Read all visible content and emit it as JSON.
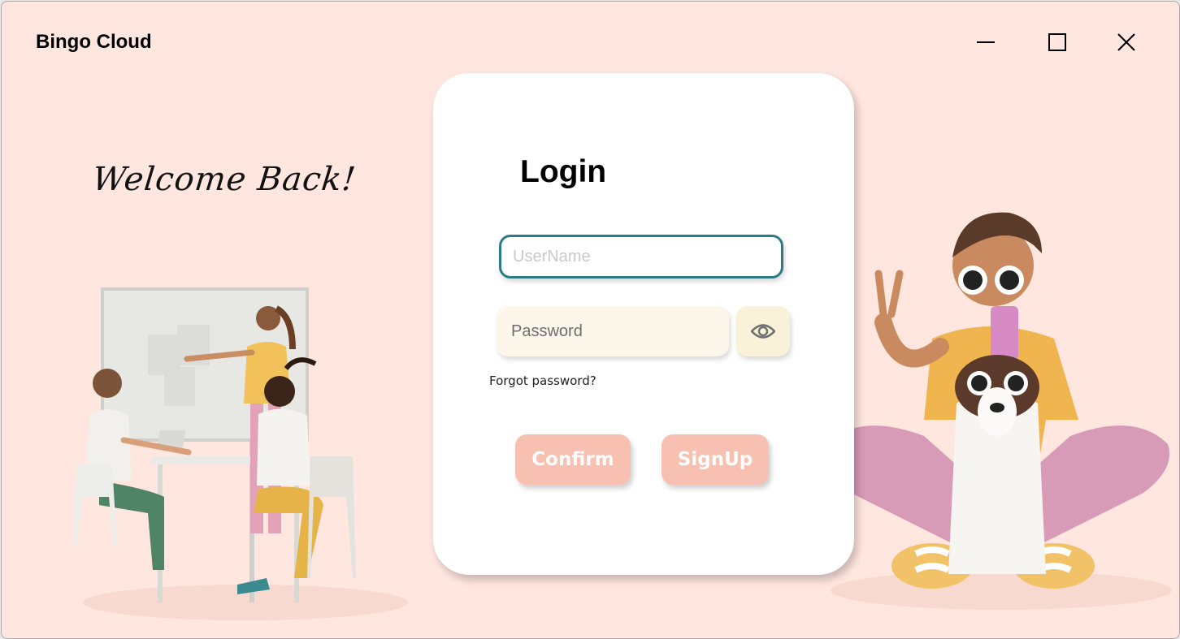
{
  "window": {
    "title": "Bingo Cloud",
    "controls": [
      "minimize-icon",
      "maximize-icon",
      "close-icon"
    ]
  },
  "hero": {
    "welcome_text": "Welcome Back!"
  },
  "login": {
    "title": "Login",
    "username": {
      "value": "",
      "placeholder": "UserName"
    },
    "password": {
      "value": "",
      "placeholder": "Password"
    },
    "show_password_icon": "eye-icon",
    "forgot_link": "Forgot password?",
    "confirm_label": "Confirm",
    "signup_label": "SignUp"
  },
  "colors": {
    "background": "#ffe6df",
    "card": "#ffffff",
    "focus_border": "#2e7a85",
    "button": "#f7c0b0",
    "password_field": "#fcf7ea"
  }
}
